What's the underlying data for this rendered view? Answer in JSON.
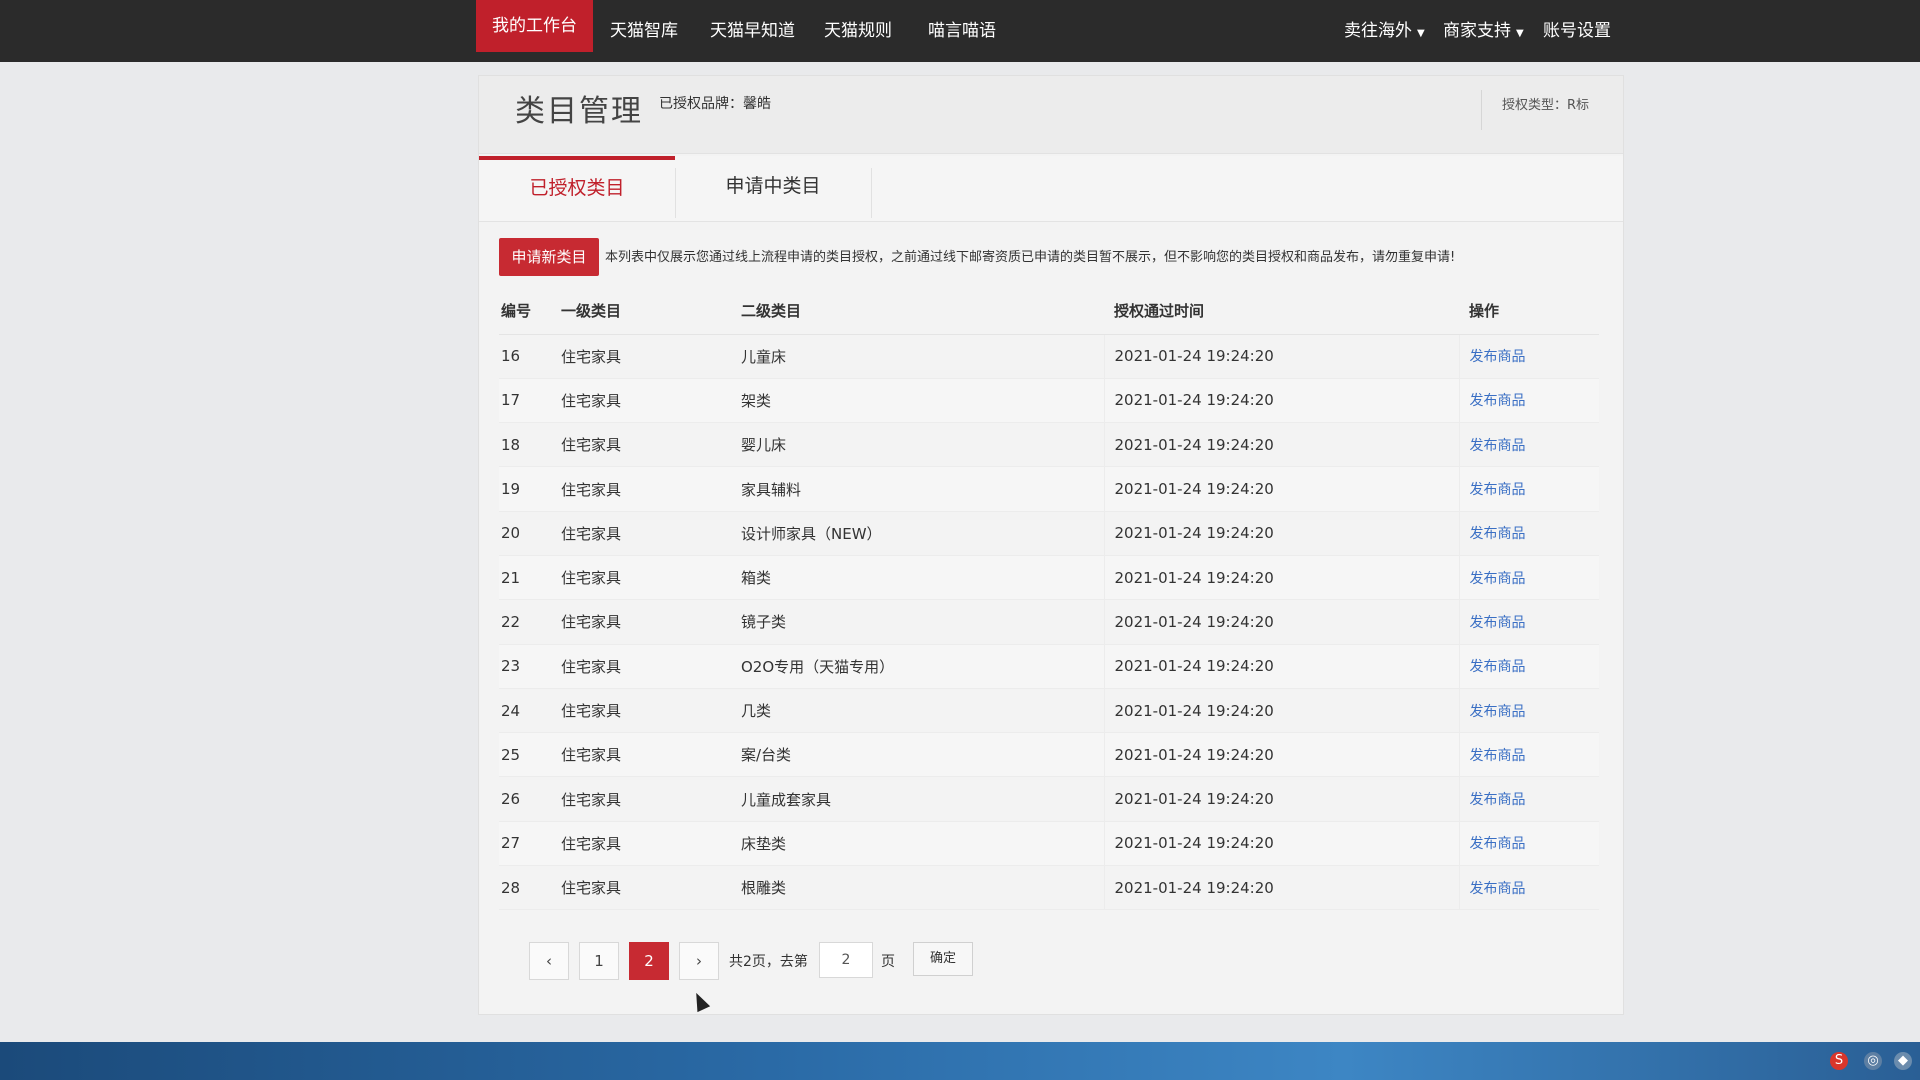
{
  "topnav": {
    "items": [
      {
        "label": "我的工作台"
      },
      {
        "label": "天猫智库"
      },
      {
        "label": "天猫早知道"
      },
      {
        "label": "天猫规则"
      },
      {
        "label": "喵言喵语"
      }
    ],
    "right_items": [
      {
        "label": "卖往海外"
      },
      {
        "label": "商家支持"
      },
      {
        "label": "账号设置"
      }
    ]
  },
  "header": {
    "title": "类目管理",
    "brand_info": "已授权品牌：馨皓",
    "auth_type": "授权类型：R标"
  },
  "tabs": [
    {
      "label": "已授权类目"
    },
    {
      "label": "申请中类目"
    }
  ],
  "apply_button": "申请新类目",
  "notice": "本列表中仅展示您通过线上流程申请的类目授权，之前通过线下邮寄资质已申请的类目暂不展示，但不影响您的类目授权和商品发布，请勿重复申请!",
  "table": {
    "headers": [
      "编号",
      "一级类目",
      "二级类目",
      "授权通过时间",
      "操作"
    ],
    "rows": [
      {
        "id": "16",
        "cat1": "住宅家具",
        "cat2": "儿童床",
        "time": "2021-01-24 19:24:20",
        "op": "发布商品"
      },
      {
        "id": "17",
        "cat1": "住宅家具",
        "cat2": "架类",
        "time": "2021-01-24 19:24:20",
        "op": "发布商品"
      },
      {
        "id": "18",
        "cat1": "住宅家具",
        "cat2": "婴儿床",
        "time": "2021-01-24 19:24:20",
        "op": "发布商品"
      },
      {
        "id": "19",
        "cat1": "住宅家具",
        "cat2": "家具辅料",
        "time": "2021-01-24 19:24:20",
        "op": "发布商品"
      },
      {
        "id": "20",
        "cat1": "住宅家具",
        "cat2": "设计师家具（NEW）",
        "time": "2021-01-24 19:24:20",
        "op": "发布商品"
      },
      {
        "id": "21",
        "cat1": "住宅家具",
        "cat2": "箱类",
        "time": "2021-01-24 19:24:20",
        "op": "发布商品"
      },
      {
        "id": "22",
        "cat1": "住宅家具",
        "cat2": "镜子类",
        "time": "2021-01-24 19:24:20",
        "op": "发布商品"
      },
      {
        "id": "23",
        "cat1": "住宅家具",
        "cat2": "O2O专用（天猫专用）",
        "time": "2021-01-24 19:24:20",
        "op": "发布商品"
      },
      {
        "id": "24",
        "cat1": "住宅家具",
        "cat2": "几类",
        "time": "2021-01-24 19:24:20",
        "op": "发布商品"
      },
      {
        "id": "25",
        "cat1": "住宅家具",
        "cat2": "案/台类",
        "time": "2021-01-24 19:24:20",
        "op": "发布商品"
      },
      {
        "id": "26",
        "cat1": "住宅家具",
        "cat2": "儿童成套家具",
        "time": "2021-01-24 19:24:20",
        "op": "发布商品"
      },
      {
        "id": "27",
        "cat1": "住宅家具",
        "cat2": "床垫类",
        "time": "2021-01-24 19:24:20",
        "op": "发布商品"
      },
      {
        "id": "28",
        "cat1": "住宅家具",
        "cat2": "根雕类",
        "time": "2021-01-24 19:24:20",
        "op": "发布商品"
      }
    ]
  },
  "pager": {
    "prev": "‹",
    "next": "›",
    "pages": [
      "1",
      "2"
    ],
    "current": "2",
    "total_text": "共2页，去第",
    "goto_value": "2",
    "page_suffix": "页",
    "confirm": "确定"
  },
  "colors": {
    "accent": "#c0202b",
    "nav_bg": "#2b2b2b",
    "link": "#3a6fc4"
  }
}
